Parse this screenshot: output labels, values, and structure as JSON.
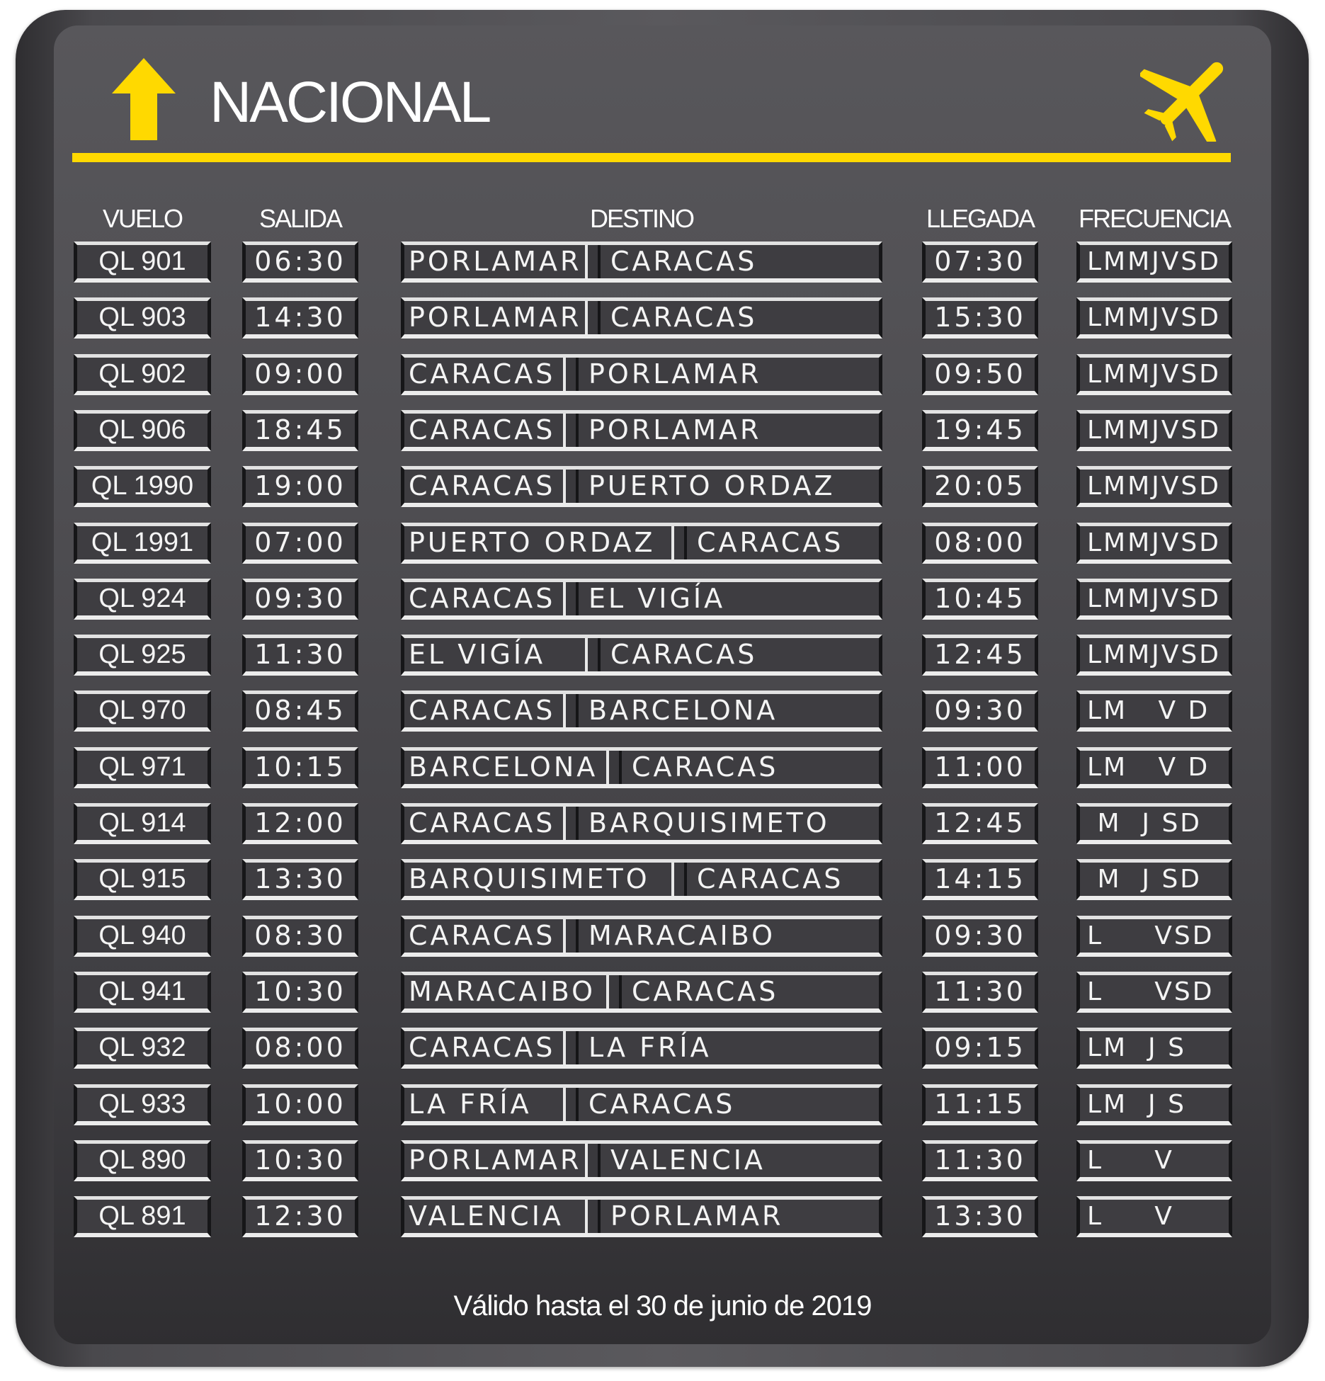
{
  "board": {
    "title": "NACIONAL",
    "accent_color": "#ffd900",
    "icons": [
      "up-arrow-icon",
      "airplane-icon"
    ],
    "columns": {
      "vuelo": "VUELO",
      "salida": "SALIDA",
      "destino": "DESTINO",
      "llegada": "LLEGADA",
      "frecuencia": "FRECUENCIA"
    },
    "flights": [
      {
        "vuelo": "QL 901",
        "salida": "06:30",
        "origen": "PORLAMAR",
        "destino": "CARACAS",
        "llegada": "07:30",
        "frecuencia": "LMMJVSD"
      },
      {
        "vuelo": "QL 903",
        "salida": "14:30",
        "origen": "PORLAMAR",
        "destino": "CARACAS",
        "llegada": "15:30",
        "frecuencia": "LMMJVSD"
      },
      {
        "vuelo": "QL 902",
        "salida": "09:00",
        "origen": "CARACAS",
        "destino": "PORLAMAR",
        "llegada": "09:50",
        "frecuencia": "LMMJVSD"
      },
      {
        "vuelo": "QL 906",
        "salida": "18:45",
        "origen": "CARACAS",
        "destino": "PORLAMAR",
        "llegada": "19:45",
        "frecuencia": "LMMJVSD"
      },
      {
        "vuelo": "QL 1990",
        "salida": "19:00",
        "origen": "CARACAS",
        "destino": "PUERTO ORDAZ",
        "llegada": "20:05",
        "frecuencia": "LMMJVSD"
      },
      {
        "vuelo": "QL 1991",
        "salida": "07:00",
        "origen": "PUERTO ORDAZ",
        "destino": "CARACAS",
        "llegada": "08:00",
        "frecuencia": "LMMJVSD"
      },
      {
        "vuelo": "QL 924",
        "salida": "09:30",
        "origen": "CARACAS",
        "destino": "EL VIGÍA",
        "llegada": "10:45",
        "frecuencia": "LMMJVSD"
      },
      {
        "vuelo": "QL 925",
        "salida": "11:30",
        "origen": "EL VIGÍA",
        "destino": "CARACAS",
        "llegada": "12:45",
        "frecuencia": "LMMJVSD"
      },
      {
        "vuelo": "QL 970",
        "salida": "08:45",
        "origen": "CARACAS",
        "destino": "BARCELONA",
        "llegada": "09:30",
        "frecuencia": "LM   V D"
      },
      {
        "vuelo": "QL 971",
        "salida": "10:15",
        "origen": "BARCELONA",
        "destino": "CARACAS",
        "llegada": "11:00",
        "frecuencia": "LM   V D"
      },
      {
        "vuelo": "QL 914",
        "salida": "12:00",
        "origen": "CARACAS",
        "destino": "BARQUISIMETO",
        "llegada": "12:45",
        "frecuencia": " M  J SD"
      },
      {
        "vuelo": "QL 915",
        "salida": "13:30",
        "origen": "BARQUISIMETO",
        "destino": "CARACAS",
        "llegada": "14:15",
        "frecuencia": " M  J SD"
      },
      {
        "vuelo": "QL 940",
        "salida": "08:30",
        "origen": "CARACAS",
        "destino": "MARACAIBO",
        "llegada": "09:30",
        "frecuencia": "L     VSD"
      },
      {
        "vuelo": "QL 941",
        "salida": "10:30",
        "origen": "MARACAIBO",
        "destino": "CARACAS",
        "llegada": "11:30",
        "frecuencia": "L     VSD"
      },
      {
        "vuelo": "QL 932",
        "salida": "08:00",
        "origen": "CARACAS",
        "destino": "LA FRÍA",
        "llegada": "09:15",
        "frecuencia": "LM  J S"
      },
      {
        "vuelo": "QL 933",
        "salida": "10:00",
        "origen": "LA FRÍA",
        "destino": "CARACAS",
        "llegada": "11:15",
        "frecuencia": "LM  J S"
      },
      {
        "vuelo": "QL 890",
        "salida": "10:30",
        "origen": "PORLAMAR",
        "destino": "VALENCIA",
        "llegada": "11:30",
        "frecuencia": "L     V"
      },
      {
        "vuelo": "QL 891",
        "salida": "12:30",
        "origen": "VALENCIA",
        "destino": "PORLAMAR",
        "llegada": "13:30",
        "frecuencia": "L     V"
      }
    ],
    "footer": "Válido hasta el 30 de junio de 2019"
  }
}
